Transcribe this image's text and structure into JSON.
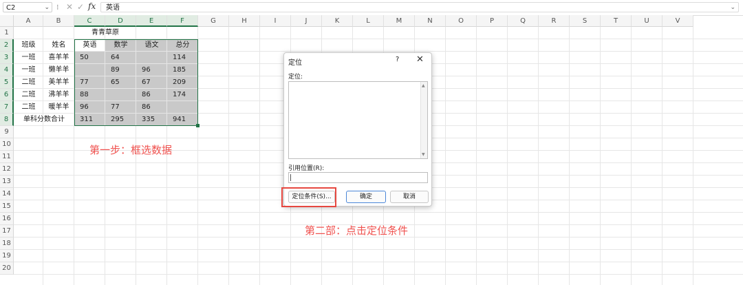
{
  "formula_bar": {
    "name_box": "C2",
    "fx_label": "fx",
    "content": "英语"
  },
  "columns": [
    "A",
    "B",
    "C",
    "D",
    "E",
    "F",
    "G",
    "H",
    "I",
    "J",
    "K",
    "L",
    "M",
    "N",
    "O",
    "P",
    "Q",
    "R",
    "S",
    "T",
    "U",
    "V"
  ],
  "rows": [
    "1",
    "2",
    "3",
    "4",
    "5",
    "6",
    "7",
    "8",
    "9",
    "10",
    "11",
    "12",
    "13",
    "14",
    "15",
    "16",
    "17",
    "18",
    "19",
    "20"
  ],
  "table": {
    "title": "青青草原",
    "headers": [
      "班级",
      "姓名",
      "英语",
      "数学",
      "语文",
      "总分"
    ],
    "rows": [
      [
        "一班",
        "喜羊羊",
        "50",
        "64",
        "",
        "114"
      ],
      [
        "一班",
        "懒羊羊",
        "",
        "89",
        "96",
        "185"
      ],
      [
        "二班",
        "美羊羊",
        "77",
        "65",
        "67",
        "209"
      ],
      [
        "二班",
        "沸羊羊",
        "88",
        "",
        "86",
        "174"
      ],
      [
        "二班",
        "暖羊羊",
        "96",
        "77",
        "86",
        ""
      ]
    ],
    "total_label": "单科分数合计",
    "totals": [
      "311",
      "295",
      "335",
      "941"
    ]
  },
  "annotations": {
    "step1": "第一步：框选数据",
    "step2": "第二部：点击定位条件"
  },
  "dialog": {
    "title": "定位",
    "help": "?",
    "close": "✕",
    "goto_label": "定位:",
    "reference_label": "引用位置(R):",
    "reference_value": "",
    "special_button": "定位条件(S)...",
    "ok_button": "确定",
    "cancel_button": "取消"
  },
  "colors": {
    "accent_green": "#217346",
    "selection_gray": "#c9c9c9",
    "annotation_red": "#f0524f",
    "highlight_box": "#e6473f"
  }
}
